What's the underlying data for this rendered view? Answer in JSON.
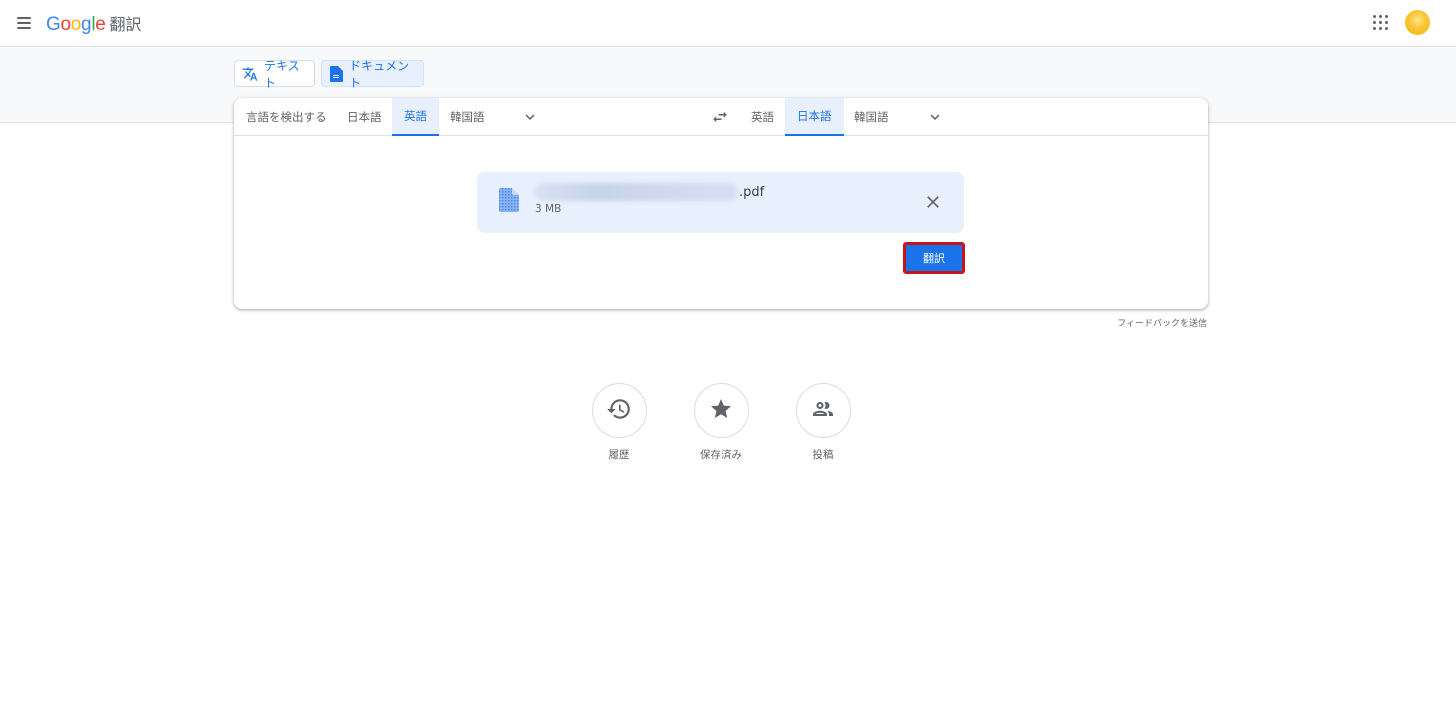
{
  "header": {
    "logo_google": [
      "G",
      "o",
      "o",
      "g",
      "l",
      "e"
    ],
    "logo_product": "翻訳"
  },
  "modes": {
    "text_label": "テキスト",
    "document_label": "ドキュメント",
    "active": "document"
  },
  "source_langs": [
    "言語を検出する",
    "日本語",
    "英語",
    "韓国語"
  ],
  "source_active": "英語",
  "target_langs": [
    "英語",
    "日本語",
    "韓国語"
  ],
  "target_active": "日本語",
  "file": {
    "extension": ".pdf",
    "size": "3 MB"
  },
  "translate_button": "翻訳",
  "feedback_link": "フィードバックを送信",
  "actions": [
    {
      "label": "履歴",
      "icon": "history-icon"
    },
    {
      "label": "保存済み",
      "icon": "star-icon"
    },
    {
      "label": "投稿",
      "icon": "people-icon"
    }
  ],
  "colors": {
    "accent": "#1a73e8",
    "highlight_border": "#c4161c"
  }
}
